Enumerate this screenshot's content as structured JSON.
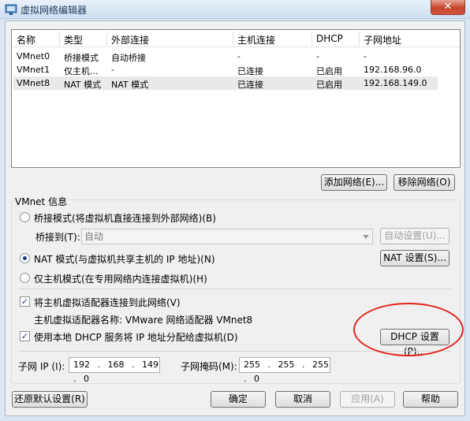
{
  "window": {
    "title": "虚拟网络编辑器",
    "close_label": "✕"
  },
  "columns": [
    "名称",
    "类型",
    "外部连接",
    "主机连接",
    "DHCP",
    "子网地址"
  ],
  "rows": [
    [
      "VMnet0",
      "桥接模式",
      "自动桥接",
      "-",
      "-",
      "-"
    ],
    [
      "VMnet1",
      "仅主机...",
      "-",
      "已连接",
      "已启用",
      "192.168.96.0"
    ],
    [
      "VMnet8",
      "NAT 模式",
      "NAT 模式",
      "已连接",
      "已启用",
      "192.168.149.0"
    ]
  ],
  "list_buttons": {
    "add": "添加网络(E)...",
    "remove": "移除网络(O)"
  },
  "info": {
    "group_label": "VMnet 信息",
    "bridged_label": "桥接模式(将虚拟机直接连接到外部网络)(B)",
    "bridged_to_label": "桥接到(T):",
    "bridged_to_value": "自动",
    "auto_settings": "自动设置(U)...",
    "nat_label": "NAT 模式(与虚拟机共享主机的 IP 地址)(N)",
    "nat_settings": "NAT 设置(S)...",
    "hostonly_label": "仅主机模式(在专用网络内连接虚拟机)(H)",
    "connect_adapter_label": "将主机虚拟适配器连接到此网络(V)",
    "adapter_name_label": "主机虚拟适配器名称: VMware 网络适配器 VMnet8",
    "dhcp_label": "使用本地 DHCP 服务将 IP 地址分配给虚拟机(D)",
    "dhcp_settings": "DHCP 设置(P)...",
    "subnet_ip_label": "子网 IP (I):",
    "subnet_ip_value": "192 . 168 . 149 . 0",
    "subnet_mask_label": "子网掩码(M):",
    "subnet_mask_value": "255 . 255 . 255 . 0",
    "selected_mode": "nat",
    "connect_adapter_checked": true,
    "dhcp_checked": true
  },
  "footer": {
    "restore": "还原默认设置(R)",
    "ok": "确定",
    "cancel": "取消",
    "apply": "应用(A)",
    "help": "帮助"
  },
  "colors": {
    "annotation": "#e4231b",
    "accent": "#1a3c8c"
  }
}
